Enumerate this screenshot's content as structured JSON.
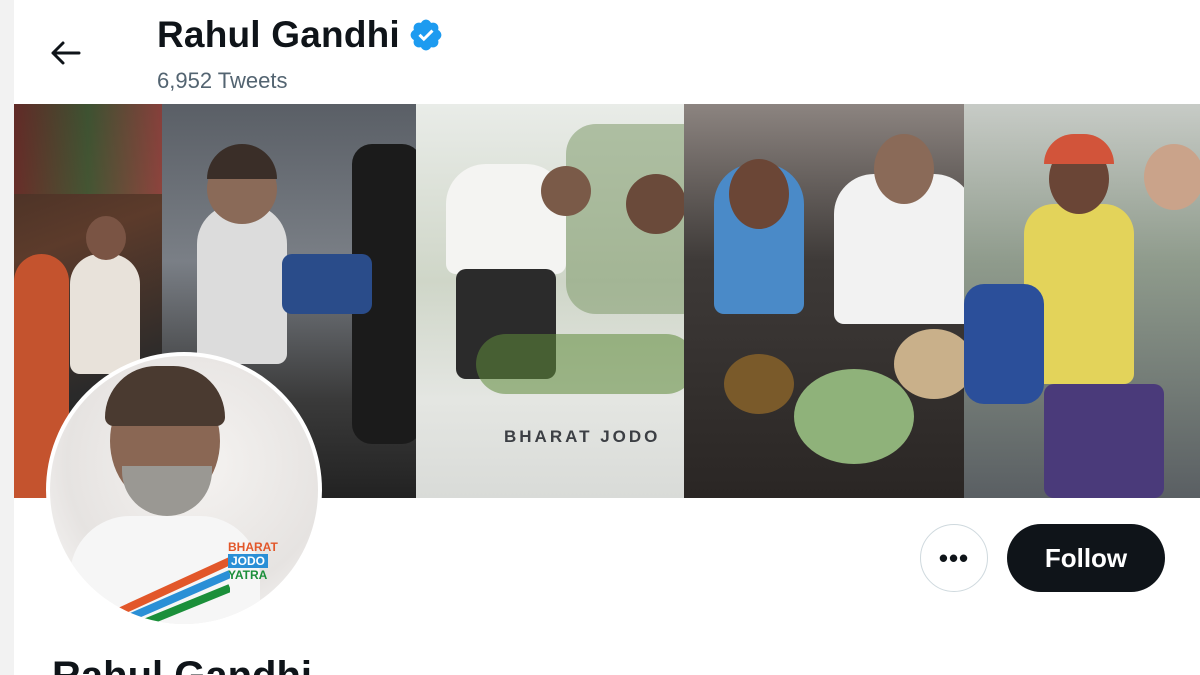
{
  "header": {
    "name": "Rahul Gandhi",
    "verified": true,
    "tweets_count_text": "6,952 Tweets"
  },
  "banner": {
    "overlay_text": "BHARAT JODO"
  },
  "avatar": {
    "logo_lines": [
      "BHARAT",
      "JODO",
      "YATRA"
    ]
  },
  "actions": {
    "more_label": "•••",
    "follow_label": "Follow"
  },
  "profile": {
    "name_cut_off": "Rahul Gandhi"
  },
  "colors": {
    "text_primary": "#0f1419",
    "text_secondary": "#536471",
    "verified_blue": "#1d9bf0",
    "follow_bg": "#0f1419"
  },
  "icons": {
    "back": "back-arrow-icon",
    "verified": "verified-badge-icon",
    "more": "more-dots-icon"
  }
}
